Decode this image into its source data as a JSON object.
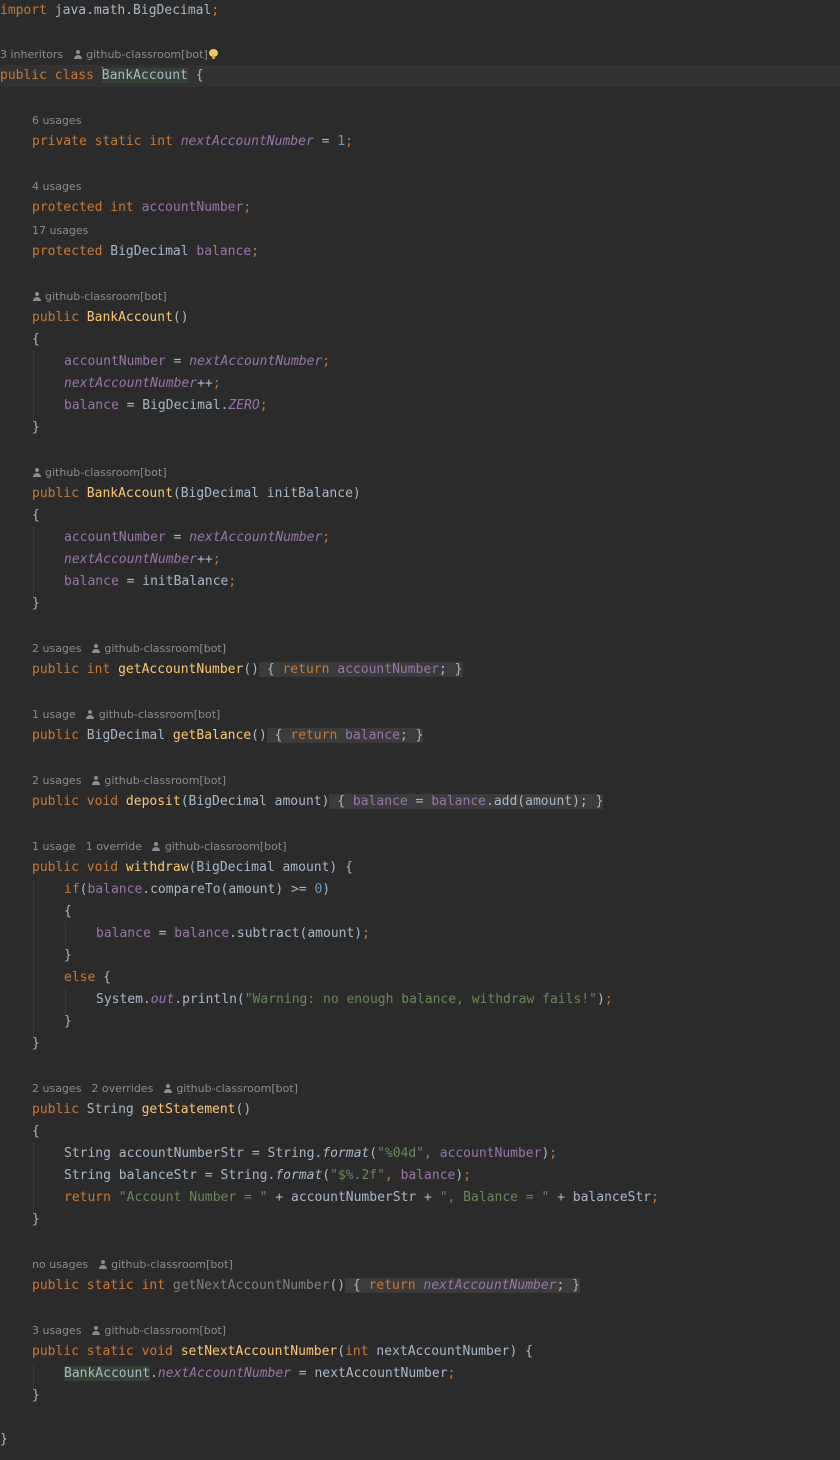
{
  "editor": {
    "language": "Java",
    "theme": "Darcula",
    "file": {
      "import_kw": "import",
      "import_path": " java.math.BigDecimal",
      "semi": ";"
    },
    "class_decl": {
      "hint_inheritors": "3 inheritors",
      "hint_author": "github-classroom[bot]",
      "public_kw": "public",
      "class_kw": "class",
      "name_first": "B",
      "name_rest": "ankAccount",
      "open": " {"
    },
    "fields": {
      "next_account_number": {
        "usages": "6 usages",
        "modifiers": "private static int",
        "name": "nextAccountNumber",
        "assign": " = ",
        "value": "1",
        "semi": ";"
      },
      "account_number": {
        "usages": "4 usages",
        "modifiers": "protected int",
        "name": "accountNumber",
        "semi": ";"
      },
      "balance": {
        "usages": "17 usages",
        "modifier": "protected",
        "type": " BigDecimal ",
        "name": "balance",
        "semi": ";"
      }
    },
    "ctor_default": {
      "author": "github-classroom[bot]",
      "public_kw": "public",
      "name": "BankAccount",
      "parens": "()",
      "open_brace": "{",
      "close_brace": "}",
      "stmt1": {
        "lhs": "accountNumber",
        "eq": " = ",
        "rhs": "nextAccountNumber",
        "semi": ";"
      },
      "stmt2": {
        "lhs": "nextAccountNumber",
        "op": "++",
        "semi": ";"
      },
      "stmt3": {
        "lhs": "balance",
        "eq": " = BigDecimal.",
        "rhs": "ZERO",
        "semi": ";"
      }
    },
    "ctor_init": {
      "author": "github-classroom[bot]",
      "public_kw": "public",
      "name": "BankAccount",
      "params": "(BigDecimal initBalance)",
      "open_brace": "{",
      "close_brace": "}",
      "stmt1": {
        "lhs": "accountNumber",
        "eq": " = ",
        "rhs": "nextAccountNumber",
        "semi": ";"
      },
      "stmt2": {
        "lhs": "nextAccountNumber",
        "op": "++",
        "semi": ";"
      },
      "stmt3": {
        "lhs": "balance",
        "eq": " = initBalance",
        "semi": ";"
      }
    },
    "get_account_number": {
      "usages": "2 usages",
      "author": "github-classroom[bot]",
      "mods": "public int",
      "name": "getAccountNumber",
      "parens": "()",
      "fold_open": " { ",
      "return_kw": "return",
      "value": "accountNumber",
      "fold_close": "; }"
    },
    "get_balance": {
      "usages": "1 usage",
      "author": "github-classroom[bot]",
      "public_kw": "public",
      "type": " BigDecimal ",
      "name": "getBalance",
      "parens": "()",
      "fold_open": " { ",
      "return_kw": "return",
      "value": "balance",
      "fold_close": "; }"
    },
    "deposit": {
      "usages": "2 usages",
      "author": "github-classroom[bot]",
      "mods": "public void",
      "name": "deposit",
      "params": "(BigDecimal amount)",
      "fold_open": " { ",
      "lhs": "balance",
      "eq": " = ",
      "recv": "balance",
      "call": ".add(amount)",
      "fold_close": "; }"
    },
    "withdraw": {
      "usages": "1 usage",
      "overrides": "1 override",
      "author": "github-classroom[bot]",
      "mods": "public void",
      "name": "withdraw",
      "params": "(BigDecimal amount) {",
      "if_kw": "if",
      "if_open": "(",
      "if_field": "balance",
      "if_rest": ".compareTo(amount) >= ",
      "if_num": "0",
      "if_close": ")",
      "brace_open": "{",
      "body_lhs": "balance",
      "body_eq": " = ",
      "body_recv": "balance",
      "body_call": ".subtract(amount)",
      "body_semi": ";",
      "brace_close": "}",
      "else_kw": "else",
      "else_open": " {",
      "print_a": "System.",
      "print_out": "out",
      "print_b": ".println(",
      "print_str": "\"Warning: no enough balance, withdraw fails!\"",
      "print_c": ")",
      "print_semi": ";",
      "else_close": "}",
      "method_close": "}"
    },
    "get_statement": {
      "usages": "2 usages",
      "overrides": "2 overrides",
      "author": "github-classroom[bot]",
      "public_kw": "public",
      "type": " String ",
      "name": "getStatement",
      "parens": "()",
      "open_brace": "{",
      "l1_a": "String accountNumberStr = String.",
      "l1_fmt": "format",
      "l1_b": "(",
      "l1_str": "\"%04d\"",
      "l1_comma": ", ",
      "l1_field": "accountNumber",
      "l1_c": ")",
      "l1_semi": ";",
      "l2_a": "String balanceStr = String.",
      "l2_fmt": "format",
      "l2_b": "(",
      "l2_str": "\"$%.2f\"",
      "l2_comma": ", ",
      "l2_field": "balance",
      "l2_c": ")",
      "l2_semi": ";",
      "l3_return": "return",
      "l3_s1": "\"Account Number = \"",
      "l3_plus1": " + accountNumberStr + ",
      "l3_s2": "\", Balance = \"",
      "l3_plus2": " + balanceStr",
      "l3_semi": ";",
      "close_brace": "}"
    },
    "get_next_account_number": {
      "usages": "no usages",
      "author": "github-classroom[bot]",
      "mods": "public static int",
      "name": "getNextAccountNumber",
      "parens": "()",
      "fold_open": " { ",
      "return_kw": "return",
      "value": "nextAccountNumber",
      "fold_close": "; }"
    },
    "set_next_account_number": {
      "usages": "3 usages",
      "author": "github-classroom[bot]",
      "mods": "public static void",
      "name": "setNextAccountNumber",
      "p_open": "(",
      "p_kw": "int",
      "p_rest": " nextAccountNumber) {",
      "body_class": "BankAccount",
      "body_dot": ".",
      "body_field": "nextAccountNumber",
      "body_rest": " = nextAccountNumber",
      "body_semi": ";",
      "close_brace": "}"
    },
    "class_close": "}"
  }
}
